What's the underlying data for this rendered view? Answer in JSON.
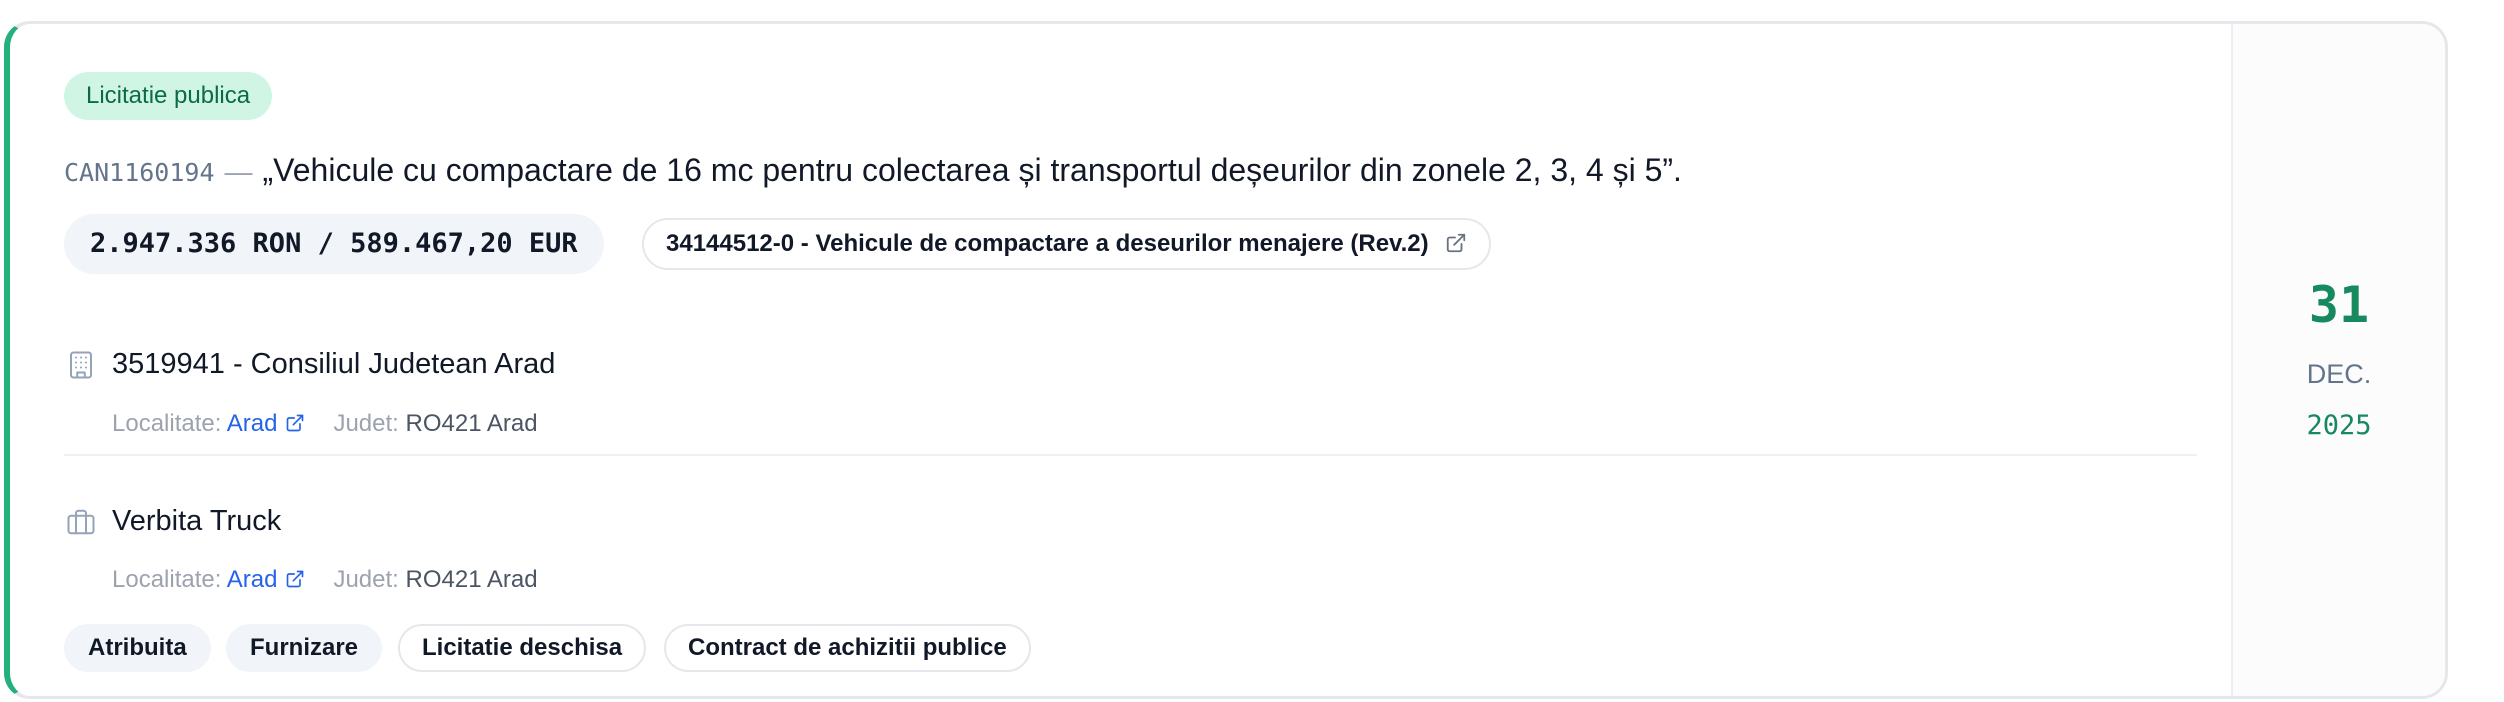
{
  "badge": "Licitatie publica",
  "notice": {
    "id": "CAN1160194",
    "separator": "—",
    "title": "„Vehicule cu compactare de 16 mc pentru colectarea și transportul deșeurilor din zonele 2, 3, 4 și 5”."
  },
  "value": "2.947.336 RON / 589.467,20 EUR",
  "cpv": "34144512-0 - Vehicule de compactare a deseurilor menajere (Rev.2)",
  "authority": {
    "icon": "building-icon",
    "name": "3519941 - Consiliul Judetean Arad",
    "localitate_label": "Localitate:",
    "localitate": "Arad",
    "judet_label": "Judet:",
    "judet": "RO421 Arad"
  },
  "supplier": {
    "icon": "briefcase-icon",
    "name": "Verbita Truck",
    "localitate_label": "Localitate:",
    "localitate": "Arad",
    "judet_label": "Judet:",
    "judet": "RO421 Arad"
  },
  "tags": [
    "Atribuita",
    "Furnizare",
    "Licitatie deschisa",
    "Contract de achizitii publice"
  ],
  "date": {
    "day": "31",
    "month": "DEC.",
    "year": "2025"
  },
  "colors": {
    "accent": "#22b07d",
    "badge_bg": "#d1f5e4",
    "badge_text": "#0b6b47",
    "link": "#2563eb",
    "date": "#16895f"
  }
}
